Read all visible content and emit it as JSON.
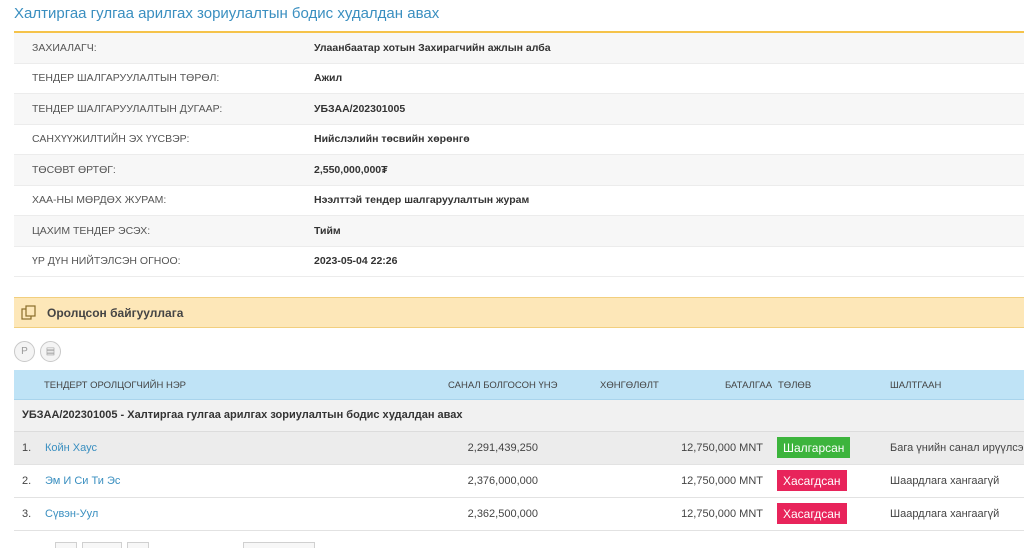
{
  "page": {
    "title": "Халтиргаа гулгаа арилгах зориулалтын бодис худалдан авах"
  },
  "info": [
    {
      "label": "ЗАХИАЛАГЧ:",
      "value": "Улаанбаатар хотын Захирагчийн ажлын алба"
    },
    {
      "label": "ТЕНДЕР ШАЛГАРУУЛАЛТЫН ТӨРӨЛ:",
      "value": "Ажил"
    },
    {
      "label": "ТЕНДЕР ШАЛГАРУУЛАЛТЫН ДУГААР:",
      "value": "УБЗАА/202301005"
    },
    {
      "label": "САНХҮҮЖИЛТИЙН ЭХ ҮҮСВЭР:",
      "value": "Нийслэлийн төсвийн хөрөнгө"
    },
    {
      "label": "ТӨСӨВТ ӨРТӨГ:",
      "value": "2,550,000,000₮"
    },
    {
      "label": "ХАА-НЫ МӨРДӨХ ЖУРАМ:",
      "value": "Нээлттэй тендер шалгаруулалтын журам"
    },
    {
      "label": "ЦАХИМ ТЕНДЕР ЭСЭХ:",
      "value": "Тийм"
    },
    {
      "label": "ҮР ДҮН НИЙТЭЛСЭН ОГНОО:",
      "value": "2023-05-04 22:26"
    }
  ],
  "section": {
    "title": "Оролцсон байгууллага",
    "icon": "copy-icon",
    "accent": "#fde7b8"
  },
  "toolbar": {
    "btn1_glyph": "Р",
    "btn2_glyph": "▤"
  },
  "table": {
    "headers": {
      "name": "ТЕНДЕРТ ОРОЛЦОГЧИЙН НЭР",
      "bid": "САНАЛ БОЛГОСОН ҮНЭ",
      "discount": "ХӨНГӨЛӨЛТ",
      "guarantee": "БАТАЛГАА",
      "status": "ТӨЛӨВ",
      "reason": "ШАЛТГААН"
    },
    "group": "УБЗАА/202301005 - Халтиргаа гулгаа арилгах зориулалтын бодис худалдан авах",
    "rows": [
      {
        "index": "1.",
        "name": "Койн Хаус",
        "bid": "2,291,439,250",
        "discount": "",
        "guarantee": "12,750,000 MNT",
        "status": "Шалгарсан",
        "status_color": "#3cb43c",
        "reason": "Бага үнийн санал ирүүлсэн."
      },
      {
        "index": "2.",
        "name": "Эм И Си Ти Эс",
        "bid": "2,376,000,000",
        "discount": "",
        "guarantee": "12,750,000 MNT",
        "status": "Хасагдсан",
        "status_color": "#e8245b",
        "reason": "Шаардлага хангаагүй"
      },
      {
        "index": "3.",
        "name": "Сүвэн-Уул",
        "bid": "2,362,500,000",
        "discount": "",
        "guarantee": "12,750,000 MNT",
        "status": "Хасагдсан",
        "status_color": "#e8245b",
        "reason": "Шаардлага хангаагүй"
      }
    ]
  },
  "colors": {
    "title": "#3a8fc0",
    "title_rule": "#f5c34a",
    "table_header": "#bfe3f6",
    "badge_success": "#3cb43c",
    "badge_rejected": "#e8245b"
  }
}
